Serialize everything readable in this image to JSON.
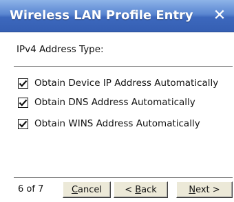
{
  "window": {
    "title": "Wireless LAN Profile Entry",
    "close_glyph": "✕"
  },
  "section": {
    "label": "IPv4 Address Type:"
  },
  "options": [
    {
      "label": "Obtain Device IP Address Automatically",
      "checked": true
    },
    {
      "label": "Obtain DNS Address Automatically",
      "checked": true
    },
    {
      "label": "Obtain WINS Address Automatically",
      "checked": true
    }
  ],
  "footer": {
    "page_indicator": "6 of 7",
    "cancel": {
      "accel": "C",
      "rest": "ancel"
    },
    "back": {
      "prefix": "< ",
      "accel": "B",
      "rest": "ack"
    },
    "next": {
      "accel": "N",
      "rest": "ext >"
    }
  },
  "colors": {
    "titlebar_top": "#8db3e8",
    "titlebar_bottom": "#355fb3",
    "button_face": "#ece9d8"
  },
  "icons": {
    "close": "close-icon",
    "check": "checkmark-icon"
  }
}
